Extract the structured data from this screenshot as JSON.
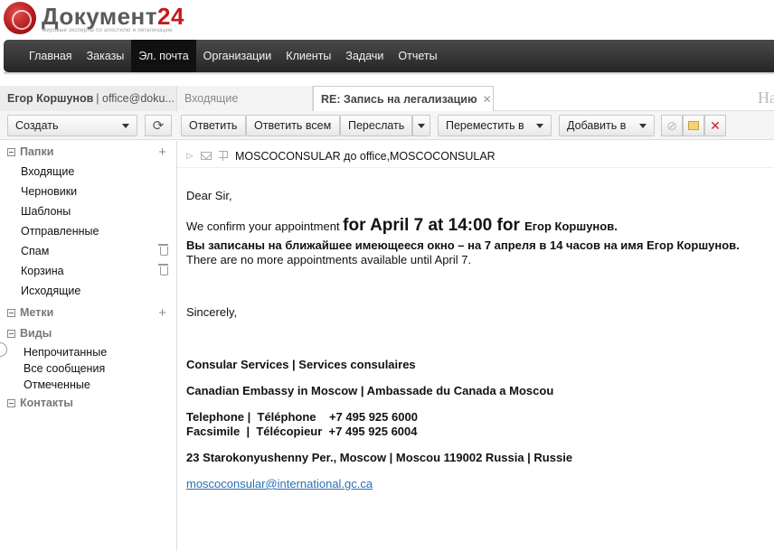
{
  "brand": {
    "name_main": "Документ",
    "name_accent": "24",
    "tagline": "мировые эксперты по апостилю и легализации"
  },
  "nav": {
    "items": [
      "Главная",
      "Заказы",
      "Эл. почта",
      "Организации",
      "Клиенты",
      "Задачи",
      "Отчеты"
    ],
    "active_index": 2
  },
  "tabs": {
    "account_name": "Егор Коршунов",
    "account_email": "| office@doku...",
    "inbox": "Входящие",
    "active": "RE: Запись на легализацию",
    "close_glyph": "✕",
    "ghost": "На"
  },
  "toolbar": {
    "create": "Создать",
    "refresh_glyph": "⟳",
    "reply": "Ответить",
    "reply_all": "Ответить всем",
    "forward": "Переслать",
    "move": "Переместить в",
    "add": "Добавить в",
    "block_glyph": "⊘",
    "close_glyph": "✕"
  },
  "sidebar": {
    "folders_label": "Папки",
    "folders": [
      "Входящие",
      "Черновики",
      "Шаблоны",
      "Отправленные",
      "Спам",
      "Корзина",
      "Исходящие"
    ],
    "tags_label": "Метки",
    "views_label": "Виды",
    "views": [
      "Непрочитанные",
      "Все сообщения",
      "Отмеченные"
    ],
    "contacts_label": "Контакты",
    "plus_glyph": "+"
  },
  "message": {
    "from_to": "MOSCOCONSULAR до office,MOSCOCONSULAR",
    "greeting": "Dear Sir,",
    "confirm_prefix": "We confirm your appointment ",
    "confirm_date": "for April 7 at 14:00  for ",
    "confirm_name": "Егор Коршунов.",
    "ru_line": "Вы записаны на ближайшее имеющееся окно – на 7 апреля в 14 часов на имя Егор Коршунов.",
    "no_more": "There are no more appointments available until April 7.",
    "closing": "Sincerely,",
    "sig_services": "Consular Services |  Services consulaires",
    "sig_embassy": "Canadian Embassy in Moscow | Ambassade du Canada a Moscou",
    "sig_phone": "Telephone |  Téléphone    +7 495 925 6000",
    "sig_fax": "Facsimile  |  Télécopieur  +7 495 925 6004",
    "sig_address": "23 Starokonyushenny Per.,  Moscow | Moscou 119002 Russia  | Russie",
    "sig_email": "moscoconsular@international.gc.ca"
  },
  "colors": {
    "brand_red": "#c41b1b",
    "nav_bg": "#2b2b2b",
    "link": "#2a6fb0",
    "delete_red": "#d32020"
  }
}
